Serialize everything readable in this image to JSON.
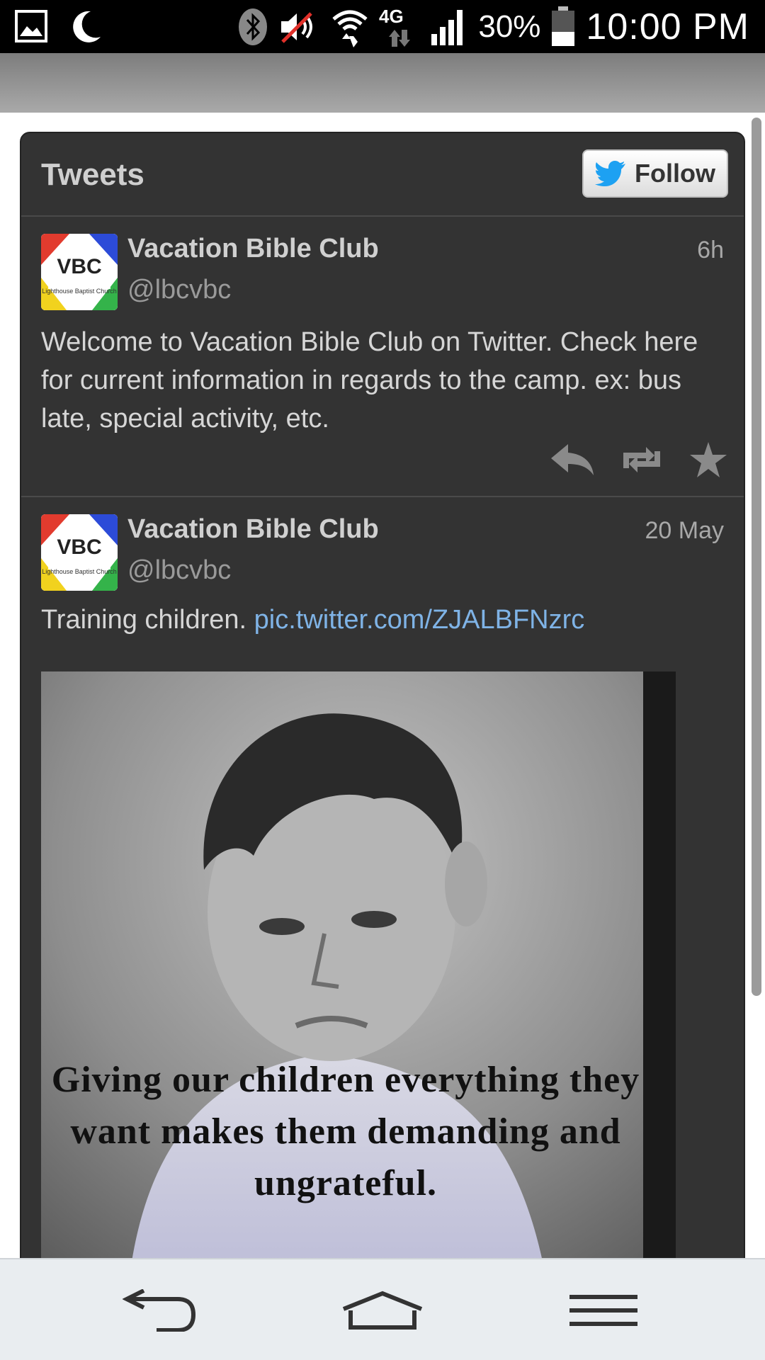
{
  "status_bar": {
    "battery": "30%",
    "time": "10:00 PM",
    "network": "4G",
    "icons": [
      "gallery-icon",
      "moon-icon",
      "bluetooth-icon",
      "mute-icon",
      "wifi-icon",
      "lte-icon",
      "signal-icon",
      "battery-icon"
    ]
  },
  "widget": {
    "title": "Tweets",
    "follow_label": "Follow",
    "brand_color": "#1da1f2"
  },
  "tweets": [
    {
      "author": "Vacation Bible Club",
      "handle": "@lbcvbc",
      "time": "6h",
      "text": "Welcome to Vacation Bible Club on Twitter.  Check here for current information in regards to the camp. ex: bus late, special activity, etc."
    },
    {
      "author": "Vacation Bible Club",
      "handle": "@lbcvbc",
      "time": "20 May",
      "text": "Training children.",
      "link": "pic.twitter.com/ZJALBFNzrc",
      "photo_caption": "Giving our children everything they want makes them demanding and ungrateful."
    }
  ],
  "avatar": {
    "text": "VBC",
    "subtitle": "Lighthouse Baptist Church"
  },
  "nav_bar": {
    "icons": [
      "back-icon",
      "home-icon",
      "menu-icon"
    ]
  }
}
